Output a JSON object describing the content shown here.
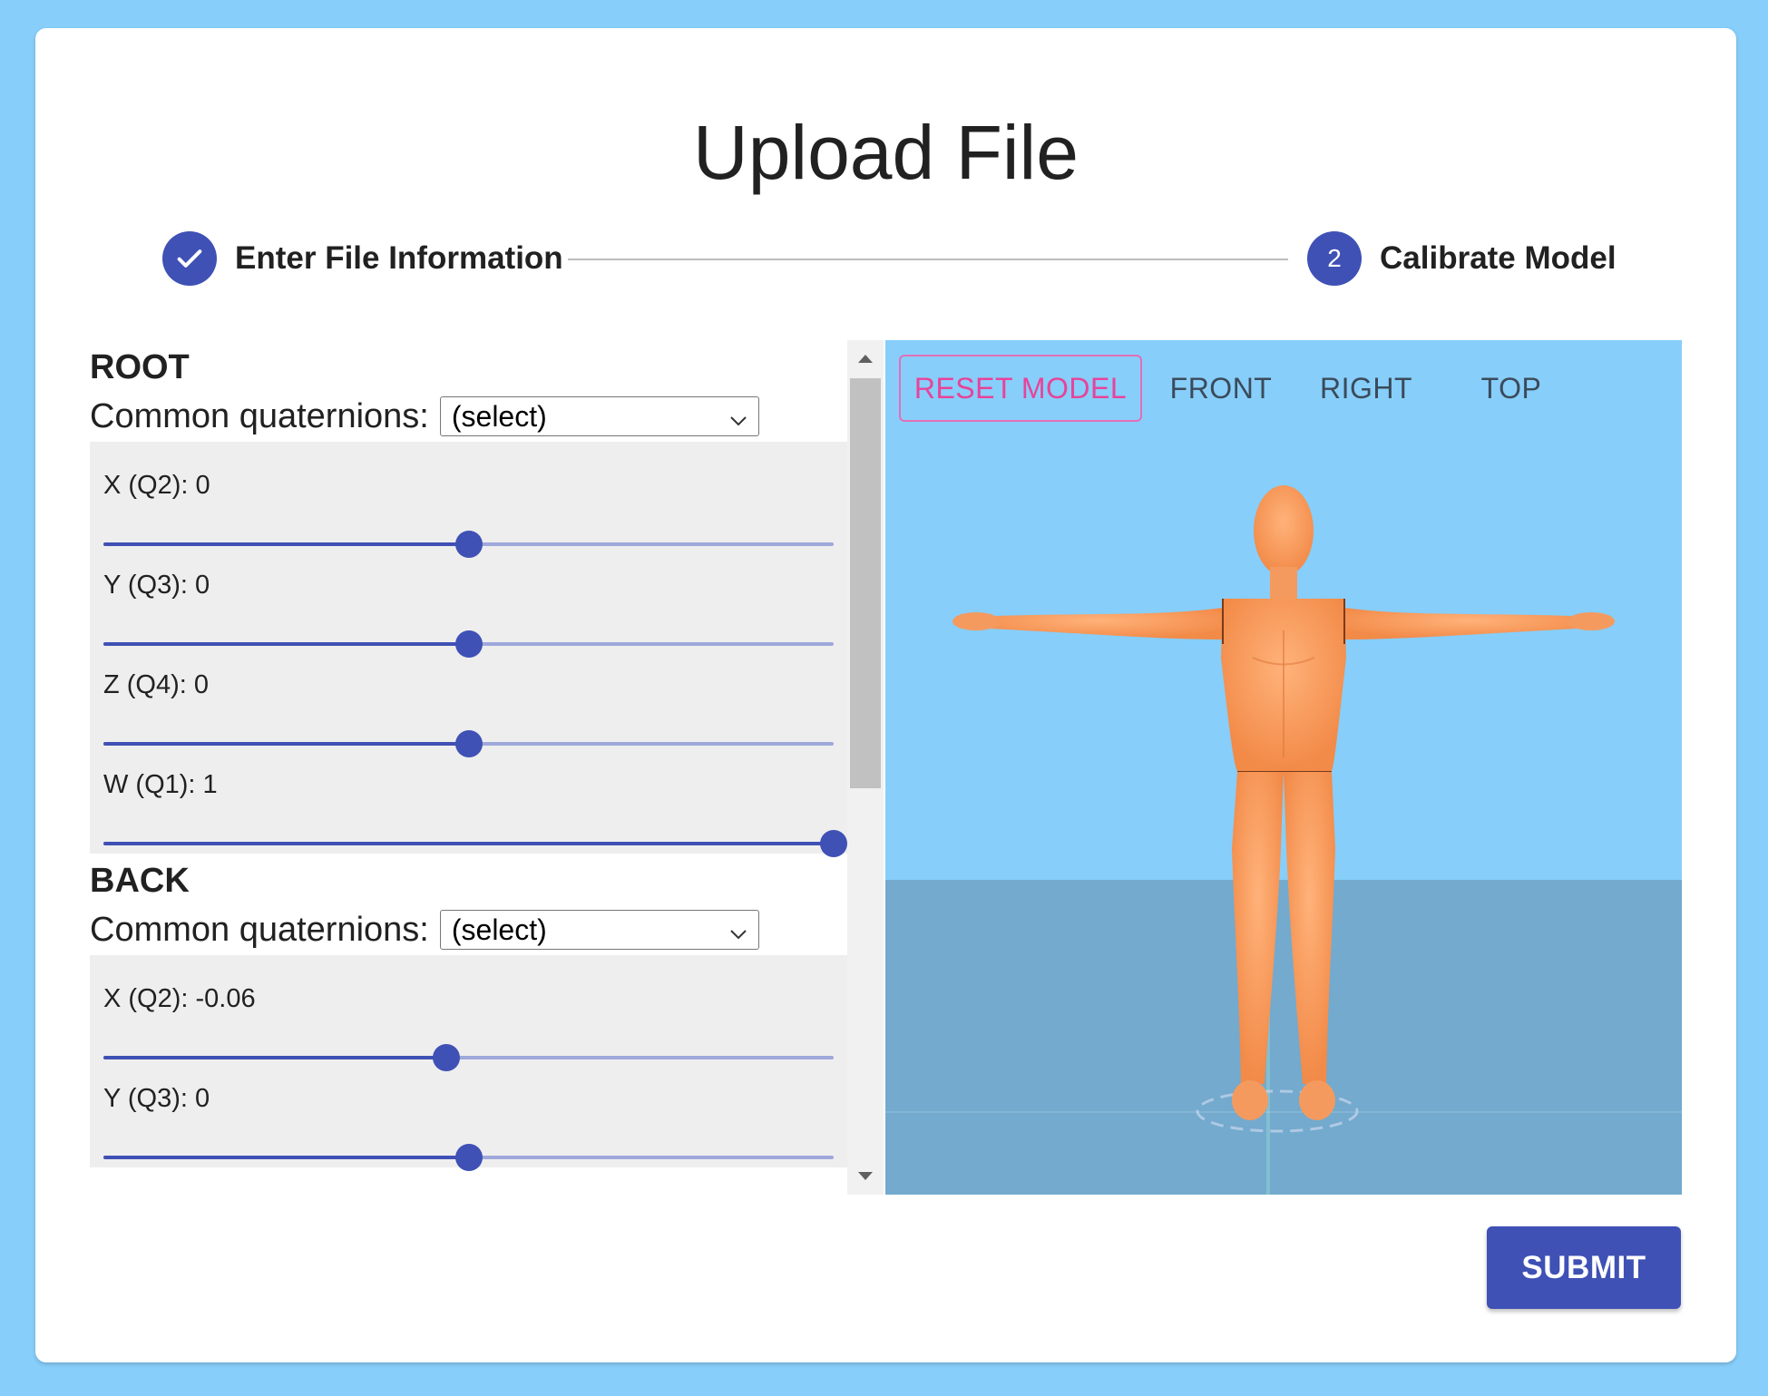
{
  "page": {
    "title": "Upload File"
  },
  "stepper": {
    "steps": [
      {
        "label": "Enter File Information",
        "state": "completed",
        "icon": "check-icon"
      },
      {
        "label": "Calibrate Model",
        "state": "active",
        "number": "2"
      }
    ]
  },
  "calibration": {
    "sections": [
      {
        "name": "ROOT",
        "common_label": "Common quaternions:",
        "select_value": "(select)",
        "sliders": [
          {
            "label": "X (Q2): 0",
            "value": 0
          },
          {
            "label": "Y (Q3): 0",
            "value": 0
          },
          {
            "label": "Z (Q4): 0",
            "value": 0
          },
          {
            "label": "W (Q1): 1",
            "value": 1
          }
        ]
      },
      {
        "name": "BACK",
        "common_label": "Common quaternions:",
        "select_value": "(select)",
        "sliders": [
          {
            "label": "X (Q2): -0.06",
            "value": -0.06
          },
          {
            "label": "Y (Q3): 0",
            "value": 0
          }
        ]
      }
    ],
    "slider_range": [
      -1,
      1
    ]
  },
  "viewer": {
    "buttons": {
      "reset": "RESET MODEL",
      "front": "FRONT",
      "right": "RIGHT",
      "top": "TOP"
    },
    "sky_color": "#87cefa",
    "floor_color": "#73aace",
    "model_color": "#ff9a5a"
  },
  "actions": {
    "submit": "SUBMIT"
  },
  "colors": {
    "primary": "#3f51b5",
    "accent": "#e8439a",
    "background": "#87cefa"
  }
}
